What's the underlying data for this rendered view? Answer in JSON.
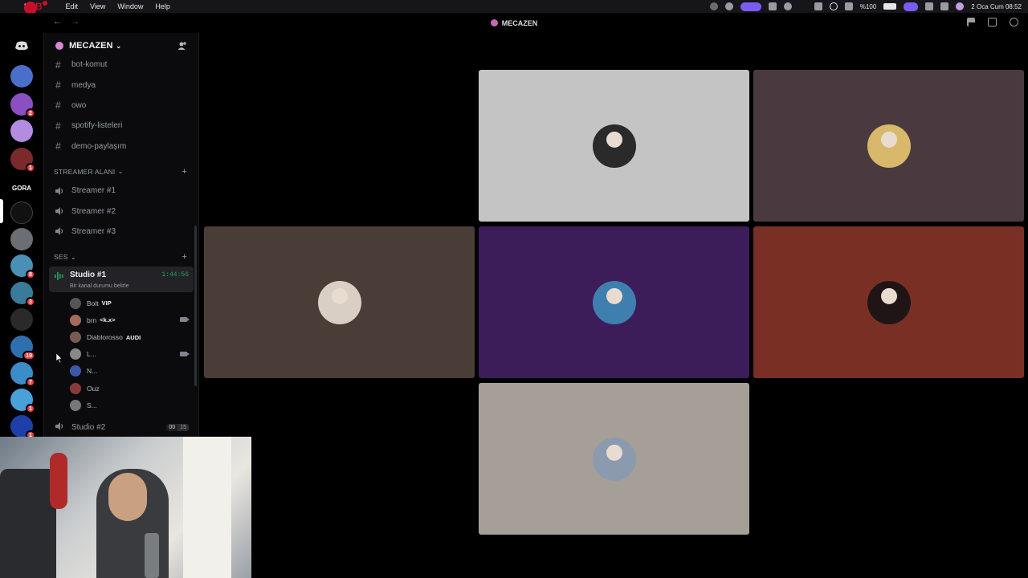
{
  "menubar": {
    "app": "D",
    "items": [
      "Edit",
      "View",
      "Window",
      "Help"
    ],
    "battery": "%100",
    "datetime": "2 Oca Cum  08:52"
  },
  "titlebar": {
    "title": "MECAZEN"
  },
  "rail": {
    "servers": [
      {
        "name": "server-1",
        "color": "#4a6fc9"
      },
      {
        "name": "server-2",
        "color": "#8a4fc0",
        "badge": "2"
      },
      {
        "name": "server-3",
        "color": "#b38be0"
      },
      {
        "name": "server-4",
        "color": "#7a2a2a",
        "badge": "1"
      },
      {
        "name": "gora",
        "label": "GORA"
      },
      {
        "name": "mecazen",
        "color": "#111",
        "active": true
      },
      {
        "name": "server-7",
        "color": "#6b6f74"
      },
      {
        "name": "server-8",
        "color": "#4b8fb5",
        "badge": "8"
      },
      {
        "name": "server-9",
        "color": "#3a7a9a",
        "badge": "3"
      },
      {
        "name": "server-10",
        "color": "#2a2a2a"
      },
      {
        "name": "server-11",
        "color": "#2f6fb0",
        "badge": "19"
      },
      {
        "name": "server-12",
        "color": "#3b8cc7",
        "badge": "7"
      },
      {
        "name": "server-13",
        "color": "#4aa0d8",
        "badge": "1"
      },
      {
        "name": "server-14",
        "color": "#1c3fa8",
        "badge": "1"
      }
    ]
  },
  "sidebar": {
    "guild_name": "MECAZEN",
    "text_channels": [
      "bot-komut",
      "medya",
      "owo",
      "spotify-listeleri",
      "demo-paylaşım"
    ],
    "streamer_category": "STREAMER ALANI",
    "streamer_channels": [
      "Streamer #1",
      "Streamer #2",
      "Streamer #3"
    ],
    "ses_category": "SES",
    "active_channel": {
      "name": "Studio #1",
      "timer": "1:44:56",
      "status": "Bir kanal durumu belirle"
    },
    "members": [
      {
        "name": "Bolt",
        "tag": "VIP",
        "color": "#555"
      },
      {
        "name": "brn",
        "tag": "<k.x>",
        "color": "#a56a5a",
        "cam": true
      },
      {
        "name": "Diablorosso",
        "tag": "AUDI",
        "color": "#7a5a50"
      },
      {
        "name": "L...",
        "tag": "",
        "color": "#888",
        "cam": true
      },
      {
        "name": "N...",
        "tag": "",
        "color": "#3d58a8"
      },
      {
        "name": "Ouz",
        "tag": "",
        "color": "#8a3a3a"
      },
      {
        "name": "S...",
        "tag": "",
        "color": "#777"
      }
    ],
    "studio2": {
      "name": "Studio #2",
      "count_a": "00",
      "count_b": "15"
    }
  },
  "tiles": [
    {
      "name": "tile-1",
      "bg": "#c4c4c4",
      "avatar": "#2a2a2a"
    },
    {
      "name": "tile-2",
      "bg": "#4a3a3f",
      "avatar": "#d8b86a"
    },
    {
      "name": "tile-3",
      "bg": "#4a3d38",
      "avatar": "#d9cfc4"
    },
    {
      "name": "tile-4",
      "bg": "#3d1c5a",
      "avatar": "#3f7fb0"
    },
    {
      "name": "tile-5",
      "bg": "#7a2f25",
      "avatar": "#1f1416"
    },
    {
      "name": "tile-6",
      "bg": "#a59f98",
      "avatar": "#8c9ab0"
    }
  ]
}
